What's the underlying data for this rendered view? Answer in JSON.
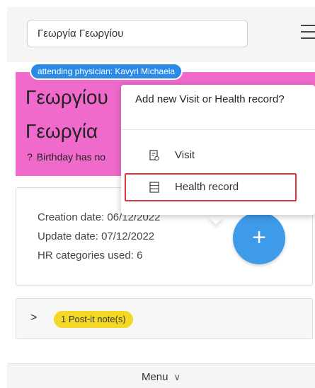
{
  "search": {
    "value": "Γεωργία Γεωργίου"
  },
  "patient": {
    "physician_badge": "attending physician: Kavyri Michaela",
    "surname": "Γεωργίου",
    "first_name": "Γεωργία",
    "birthday_icon": "?",
    "birthday_text": "Birthday has no",
    "background_color": "#f06acb"
  },
  "info": {
    "creation_date": "Creation date: 06/12/2022",
    "update_date": "Update date: 07/12/2022",
    "hr_categories": "HR categories used: 6",
    "fab_label": "+"
  },
  "postit": {
    "chevron": ">",
    "badge": "1 Post-it note(s)"
  },
  "bottom_menu": {
    "label": "Menu",
    "chevron": "∨"
  },
  "popover": {
    "title": "Add new Visit or Health record?",
    "items": [
      {
        "label": "Visit",
        "icon": "visit-icon"
      },
      {
        "label": "Health record",
        "icon": "health-record-icon",
        "highlighted": true
      }
    ]
  },
  "colors": {
    "accent": "#2b8ae8",
    "fab": "#3e9be9",
    "postit": "#f5d823",
    "highlight": "#e0363a"
  }
}
